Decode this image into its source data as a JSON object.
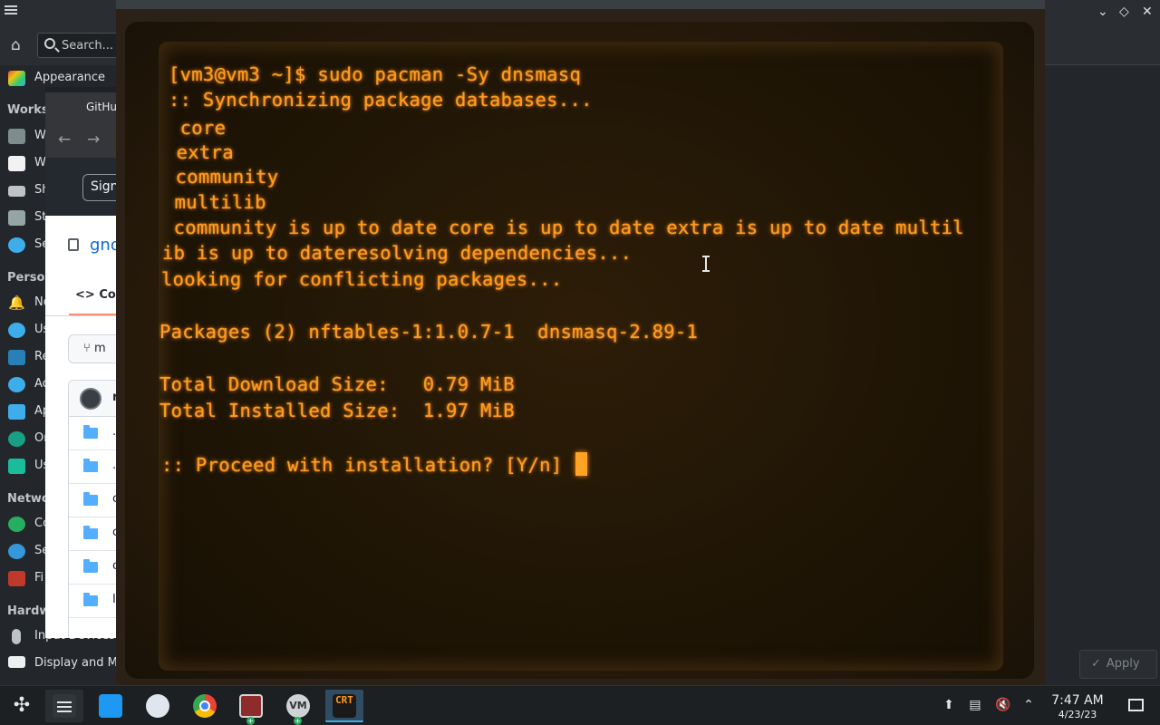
{
  "settings": {
    "search_placeholder": "Search...",
    "sidebar": {
      "appearance": "Appearance",
      "workspace_heading": "Worksp",
      "workspace_items": [
        "W",
        "W",
        "Sh",
        "St",
        "Se"
      ],
      "personalization_heading": "Person",
      "personalization_items": [
        "No",
        "Us",
        "Re",
        "Ac",
        "Ap",
        "Or",
        "Us"
      ],
      "network_heading": "Netwo",
      "network_items": [
        "Co",
        "Se",
        "Fi"
      ],
      "hardware_heading": "Hardw",
      "hardware_items": [
        "Input Devices",
        "Display and Mo"
      ]
    },
    "apply_label": "Apply"
  },
  "browser": {
    "tab_label": "GitHu",
    "sign_label": "Sign",
    "repo_label": "gno",
    "code_tab": "Co",
    "branch_label": "m",
    "commit_label": "r",
    "file_rows": [
      ".",
      ".",
      "c",
      "c",
      "c",
      "I"
    ]
  },
  "terminal": {
    "lines": [
      "[vm3@vm3 ~]$ sudo pacman -Sy dnsmasq",
      ":: Synchronizing package databases...",
      " core",
      " extra",
      " community",
      " multilib",
      " community is up to date core is up to date extra is up to date multil",
      "ib is up to dateresolving dependencies...",
      "looking for conflicting packages...",
      "",
      "Packages (2) nftables-1:1.0.7-1  dnsmasq-2.89-1",
      "",
      "Total Download Size:   0.79 MiB",
      "Total Installed Size:  1.97 MiB",
      "",
      ":: Proceed with installation? [Y/n] "
    ]
  },
  "taskbar": {
    "apps": [
      {
        "name": "application-launcher",
        "icon": "kicker-icon"
      },
      {
        "name": "overview",
        "icon": "overview-icon"
      },
      {
        "name": "discover",
        "icon": "discover-icon"
      },
      {
        "name": "steam",
        "icon": "steam-icon"
      },
      {
        "name": "chrome",
        "icon": "chrome-icon"
      },
      {
        "name": "virt-manager",
        "icon": "virt-manager-icon"
      },
      {
        "name": "vmware",
        "icon": "vmware-icon"
      },
      {
        "name": "cool-retro-term",
        "icon": "crt-icon",
        "label": "CRT"
      }
    ],
    "clock_time": "7:47 AM",
    "clock_date": "4/23/23"
  },
  "colors": {
    "terminal_amber": "#ff9a22",
    "taskbar_bg": "#1d2023",
    "active_accent": "#3daee9",
    "github_link": "#0969da"
  }
}
